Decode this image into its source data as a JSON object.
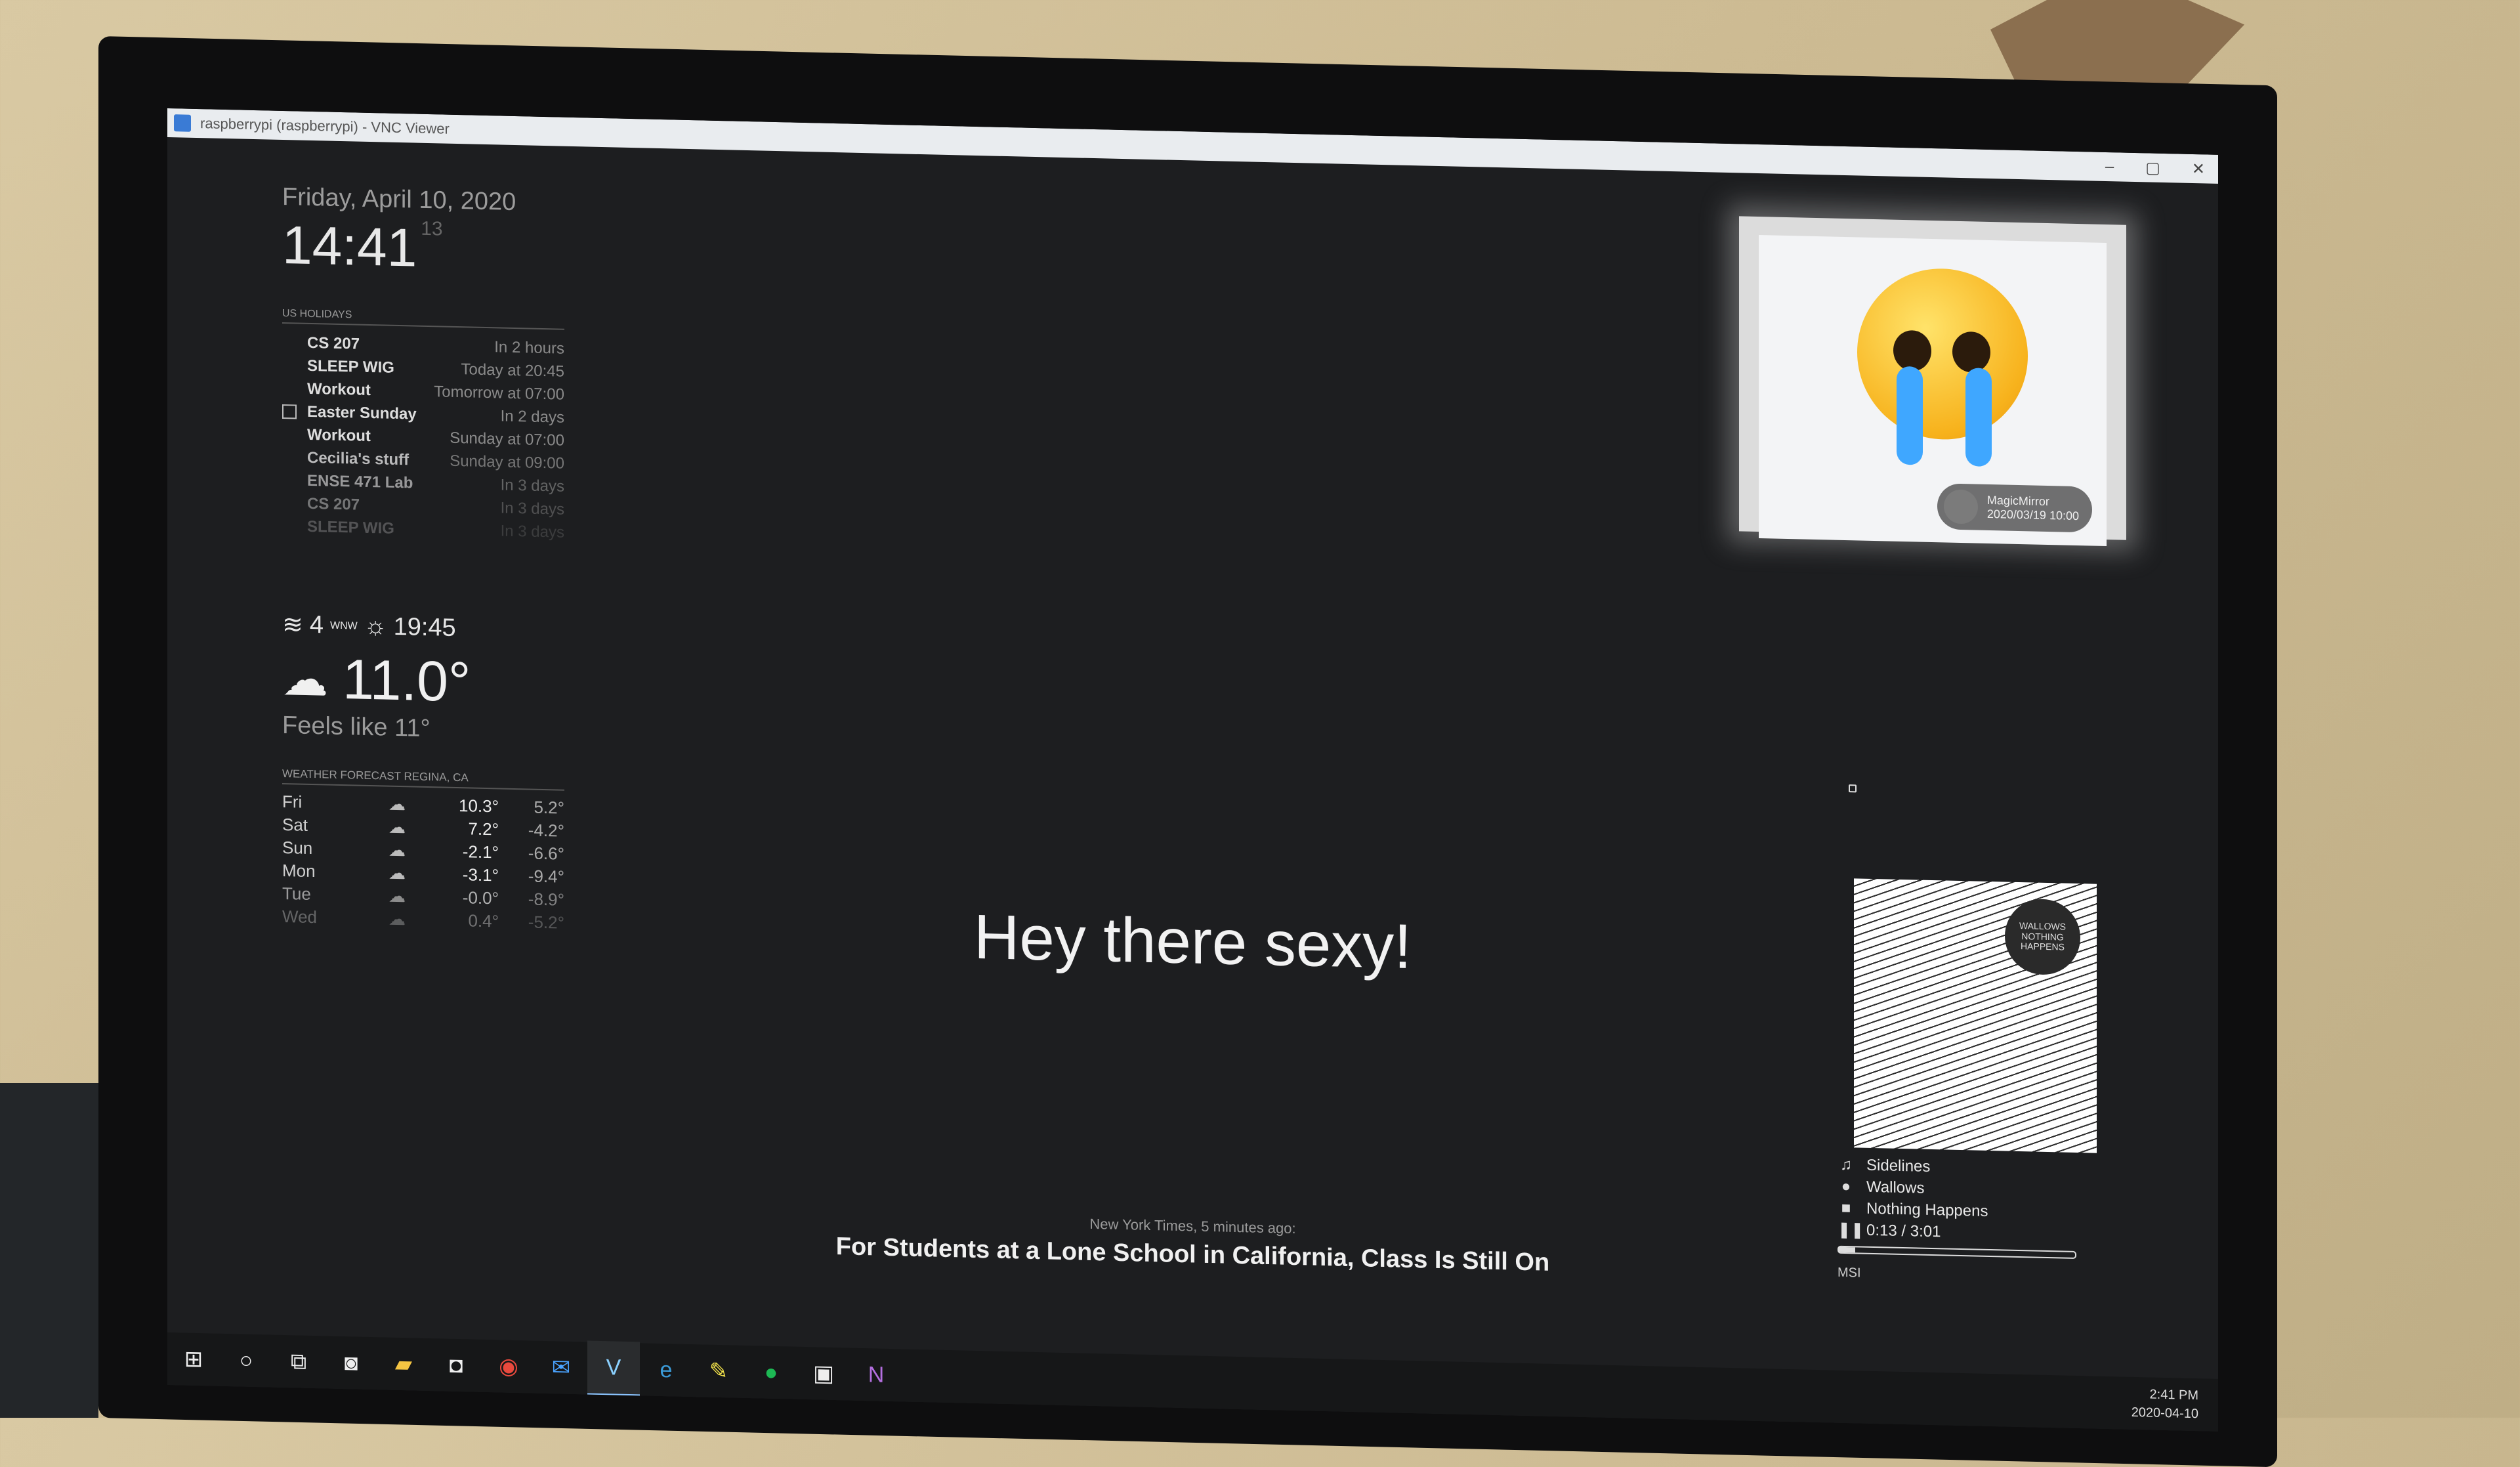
{
  "vnc": {
    "title": "raspberrypi (raspberrypi) - VNC Viewer",
    "minimize": "–",
    "maximize": "▢",
    "close": "✕"
  },
  "clock": {
    "date": "Friday, April 10, 2020",
    "time": "14:41",
    "seconds": "13"
  },
  "calendar": {
    "header": "US HOLIDAYS",
    "events": [
      {
        "title": "CS 207",
        "when": "In 2 hours"
      },
      {
        "title": "SLEEP WIG",
        "when": "Today at 20:45"
      },
      {
        "title": "Workout",
        "when": "Tomorrow at 07:00"
      },
      {
        "title": "Easter Sunday",
        "when": "In 2 days"
      },
      {
        "title": "Workout",
        "when": "Sunday at 07:00"
      },
      {
        "title": "Cecilia's stuff",
        "when": "Sunday at 09:00"
      },
      {
        "title": "ENSE 471 Lab",
        "when": "In 3 days"
      },
      {
        "title": "CS 207",
        "when": "In 3 days"
      },
      {
        "title": "SLEEP WIG",
        "when": "In 3 days"
      }
    ]
  },
  "weather": {
    "wind_speed": "4",
    "wind_dir": "WNW",
    "sunset": "19:45",
    "temperature": "11.0°",
    "feels_like": "Feels like 11°"
  },
  "forecast": {
    "header": "WEATHER FORECAST REGINA, CA",
    "days": [
      {
        "day": "Fri",
        "max": "10.3°",
        "min": "5.2°"
      },
      {
        "day": "Sat",
        "max": "7.2°",
        "min": "-4.2°"
      },
      {
        "day": "Sun",
        "max": "-2.1°",
        "min": "-6.6°"
      },
      {
        "day": "Mon",
        "max": "-3.1°",
        "min": "-9.4°"
      },
      {
        "day": "Tue",
        "max": "-0.0°",
        "min": "-8.9°"
      },
      {
        "day": "Wed",
        "max": "0.4°",
        "min": "-5.2°"
      }
    ]
  },
  "compliment": "Hey there sexy!",
  "news": {
    "source": "New York Times, 5 minutes ago:",
    "headline": "For Students at a Lone School in California, Class Is Still On"
  },
  "photo": {
    "caption_name": "MagicMirror",
    "caption_date": "2020/03/19 10:00"
  },
  "music": {
    "album_badge": "WALLOWS NOTHING HAPPENS",
    "track": "Sidelines",
    "artist": "Wallows",
    "album": "Nothing Happens",
    "time": "0:13 / 3:01",
    "progress": 0.07,
    "device": "MSI"
  },
  "taskbar": {
    "tray_time": "2:41 PM",
    "tray_date": "2020-04-10"
  }
}
